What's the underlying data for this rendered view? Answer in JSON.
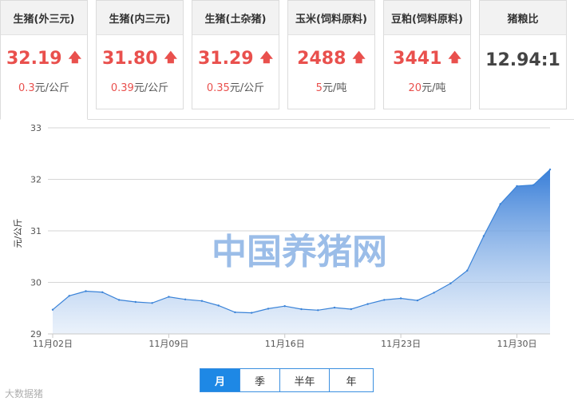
{
  "cards": [
    {
      "title": "生猪(外三元)",
      "price": "32.19",
      "change": "0.3",
      "unit": "元/公斤"
    },
    {
      "title": "生猪(内三元)",
      "price": "31.80",
      "change": "0.39",
      "unit": "元/公斤"
    },
    {
      "title": "生猪(土杂猪)",
      "price": "31.29",
      "change": "0.35",
      "unit": "元/公斤"
    },
    {
      "title": "玉米(饲料原料)",
      "price": "2488",
      "change": "5",
      "unit": "元/吨"
    },
    {
      "title": "豆粕(饲料原料)",
      "price": "3441",
      "change": "20",
      "unit": "元/吨"
    }
  ],
  "ratio_card": {
    "title": "猪粮比",
    "value": "12.94:1"
  },
  "arrow_symbol": "🡅",
  "chart_data": {
    "type": "area",
    "ylabel": "元/公斤",
    "ylim": [
      29,
      33
    ],
    "yticks": [
      29,
      30,
      31,
      32,
      33
    ],
    "x_ticks": [
      "11月02日",
      "11月09日",
      "11月16日",
      "11月23日",
      "11月30日"
    ],
    "x": [
      "11-02",
      "11-03",
      "11-04",
      "11-05",
      "11-06",
      "11-07",
      "11-08",
      "11-09",
      "11-10",
      "11-11",
      "11-12",
      "11-13",
      "11-14",
      "11-15",
      "11-16",
      "11-17",
      "11-18",
      "11-19",
      "11-20",
      "11-21",
      "11-22",
      "11-23",
      "11-24",
      "11-25",
      "11-26",
      "11-27",
      "11-28",
      "11-29",
      "11-30",
      "12-01",
      "12-02"
    ],
    "values": [
      29.47,
      29.74,
      29.83,
      29.81,
      29.66,
      29.62,
      29.6,
      29.72,
      29.67,
      29.64,
      29.55,
      29.42,
      29.41,
      29.49,
      29.54,
      29.48,
      29.46,
      29.51,
      29.48,
      29.58,
      29.66,
      29.69,
      29.65,
      29.8,
      29.98,
      30.23,
      30.9,
      31.52,
      31.87,
      31.89,
      32.19
    ],
    "watermark": "中国养猪网",
    "color": "#3a83d8"
  },
  "range_buttons": [
    "月",
    "季",
    "半年",
    "年"
  ],
  "active_range": "月",
  "corner_watermark": "大数据猪"
}
